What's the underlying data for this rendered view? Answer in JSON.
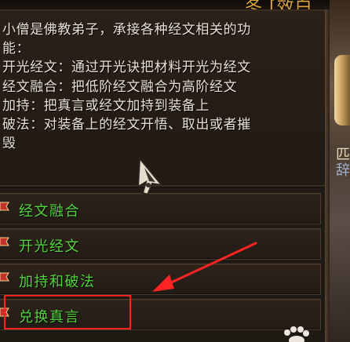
{
  "top_bar": {
    "partial_title": "冬 [效白"
  },
  "dialog": {
    "description": "小僧是佛教弟子，承接各种经文相关的功\n能：\n开光经文：通过开光诀把材料开光为经文\n经文融合：把低阶经文融合为高阶经文\n加持：把真言或经文加持到装备上\n破法：对装备上的经文开悟、取出或者摧\n毁",
    "options": [
      {
        "label": "经文融合"
      },
      {
        "label": "开光经文"
      },
      {
        "label": "加持和破法"
      },
      {
        "label": "兑换真言"
      }
    ]
  },
  "side_panel": {
    "lines": [
      "匹",
      "辞"
    ]
  },
  "colors": {
    "option_text": "#53d43e",
    "description_text": "#e9e2d4",
    "highlight_annotation": "#ff2020",
    "gold_title": "#d9a53a"
  },
  "icons": {
    "option_bullet": "flag-icon",
    "cursor": "ornate-pointer-cursor",
    "annotation_arrow": "red-arrow-icon",
    "paw": "paw-icon"
  }
}
